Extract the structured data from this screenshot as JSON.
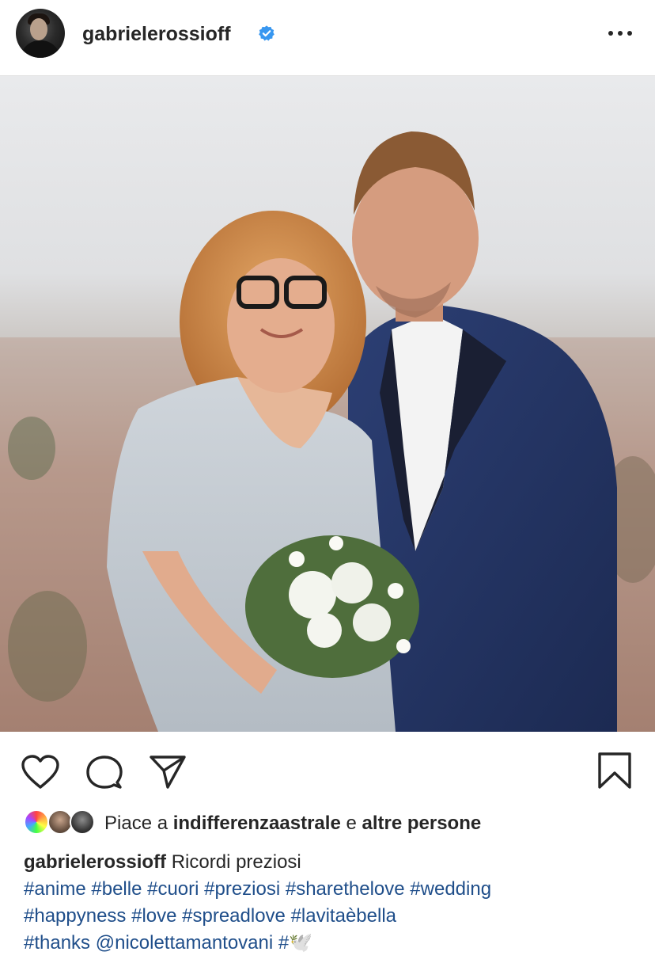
{
  "post": {
    "username": "gabrielerossioff",
    "verified": true,
    "more_icon": "more-dots-icon",
    "photo_alt": "",
    "colors": {
      "link": "#1f4e8a",
      "verified": "#3897f0",
      "text": "#262626"
    }
  },
  "actions": {
    "icons": [
      "heart-icon",
      "comment-icon",
      "share-icon",
      "bookmark-icon"
    ]
  },
  "likes": {
    "prefix": "Piace a ",
    "user": "indifferenzaastrale",
    "middle": " e ",
    "others": "altre persone"
  },
  "caption": {
    "username": "gabrielerossioff",
    "text": " Ricordi preziosi",
    "line2": "#anime #belle #cuori #preziosi #sharethelove #wedding",
    "line3": "#happyness #love #spreadlove #lavitaèbella",
    "line4_tags": "#thanks @nicolettamantovani #",
    "emoji": "🕊️"
  }
}
